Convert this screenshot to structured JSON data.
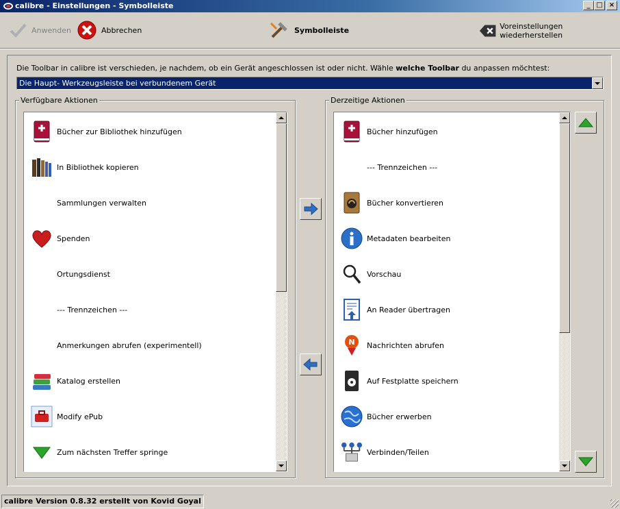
{
  "window": {
    "title": "calibre - Einstellungen - Symbolleiste"
  },
  "toolbar": {
    "apply_label": "Anwenden",
    "cancel_label": "Abbrechen",
    "section_label": "Symbolleiste",
    "reset_label": "Voreinstellungen wiederherstellen"
  },
  "content": {
    "description_prefix": "Die Toolbar in calibre ist verschieden, je nachdem, ob ein Gerät angeschlossen ist oder nicht. Wähle ",
    "description_bold": "welche Toolbar",
    "description_suffix": " du anpassen möchtest:",
    "toolbar_select_value": "Die Haupt- Werkzeugsleiste bei verbundenem Gerät"
  },
  "available": {
    "title": "Verfügbare Aktionen",
    "items": [
      {
        "label": "Bücher zur Bibliothek hinzufügen",
        "icon": "red-book-icon"
      },
      {
        "label": "In Bibliothek kopieren",
        "icon": "books-icon"
      },
      {
        "label": "Sammlungen verwalten",
        "icon": ""
      },
      {
        "label": "Spenden",
        "icon": "heart-icon"
      },
      {
        "label": "Ortungsdienst",
        "icon": ""
      },
      {
        "label": "--- Trennzeichen ---",
        "icon": ""
      },
      {
        "label": "Anmerkungen abrufen (experimentell)",
        "icon": ""
      },
      {
        "label": "Katalog erstellen",
        "icon": "catalog-icon"
      },
      {
        "label": "Modify ePub",
        "icon": "toolbox-icon"
      },
      {
        "label": "Zum nächsten Treffer springe",
        "icon": "green-arrow-down-icon"
      }
    ]
  },
  "current": {
    "title": "Derzeitige Aktionen",
    "items": [
      {
        "label": "Bücher hinzufügen",
        "icon": "red-book-icon"
      },
      {
        "label": "--- Trennzeichen ---",
        "icon": ""
      },
      {
        "label": "Bücher konvertieren",
        "icon": "convert-icon"
      },
      {
        "label": "Metadaten bearbeiten",
        "icon": "info-icon"
      },
      {
        "label": "Vorschau",
        "icon": "magnifier-icon"
      },
      {
        "label": "An Reader übertragen",
        "icon": "send-to-device-icon"
      },
      {
        "label": "Nachrichten abrufen",
        "icon": "news-icon"
      },
      {
        "label": "Auf Festplatte speichern",
        "icon": "save-icon"
      },
      {
        "label": "Bücher erwerben",
        "icon": "globe-icon"
      },
      {
        "label": "Verbinden/Teilen",
        "icon": "connect-share-icon"
      }
    ]
  },
  "statusbar": {
    "text": "calibre Version 0.8.32 erstellt von Kovid Goyal"
  },
  "colors": {
    "window_bg": "#d4d0c8",
    "title_bar": "#0a246a",
    "selection": "#0a246a",
    "move_arrow": "#2f6fc0",
    "order_arrow": "#2aa52a"
  }
}
